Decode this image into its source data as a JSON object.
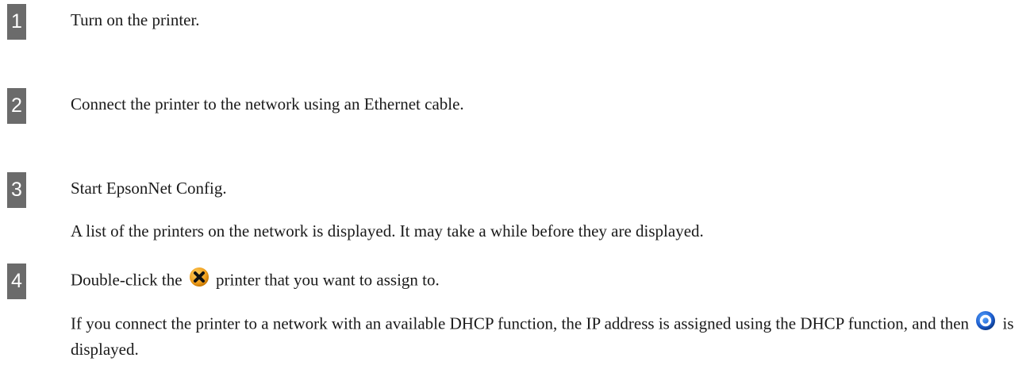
{
  "steps": [
    {
      "number": "1",
      "text": "Turn on the printer."
    },
    {
      "number": "2",
      "text": "Connect the printer to the network using an Ethernet cable."
    },
    {
      "number": "3",
      "text": "Start EpsonNet Config.",
      "note": "A list of the printers on the network is displayed. It may take a while before they are displayed."
    },
    {
      "number": "4",
      "text_before_icon": "Double-click the",
      "text_after_icon": "printer that you want to assign to.",
      "note_before_icon": "If you connect the printer to a network with an available DHCP function, the IP address is assigned using the DHCP function, and then",
      "note_after_icon": "is displayed."
    }
  ],
  "icons": {
    "error_status": "error-x-status-icon",
    "ready_status": "ready-ring-status-icon"
  },
  "colors": {
    "badge": "#6b6b6b",
    "error_icon": "#f0a020",
    "ready_icon": "#1e5fd0"
  }
}
